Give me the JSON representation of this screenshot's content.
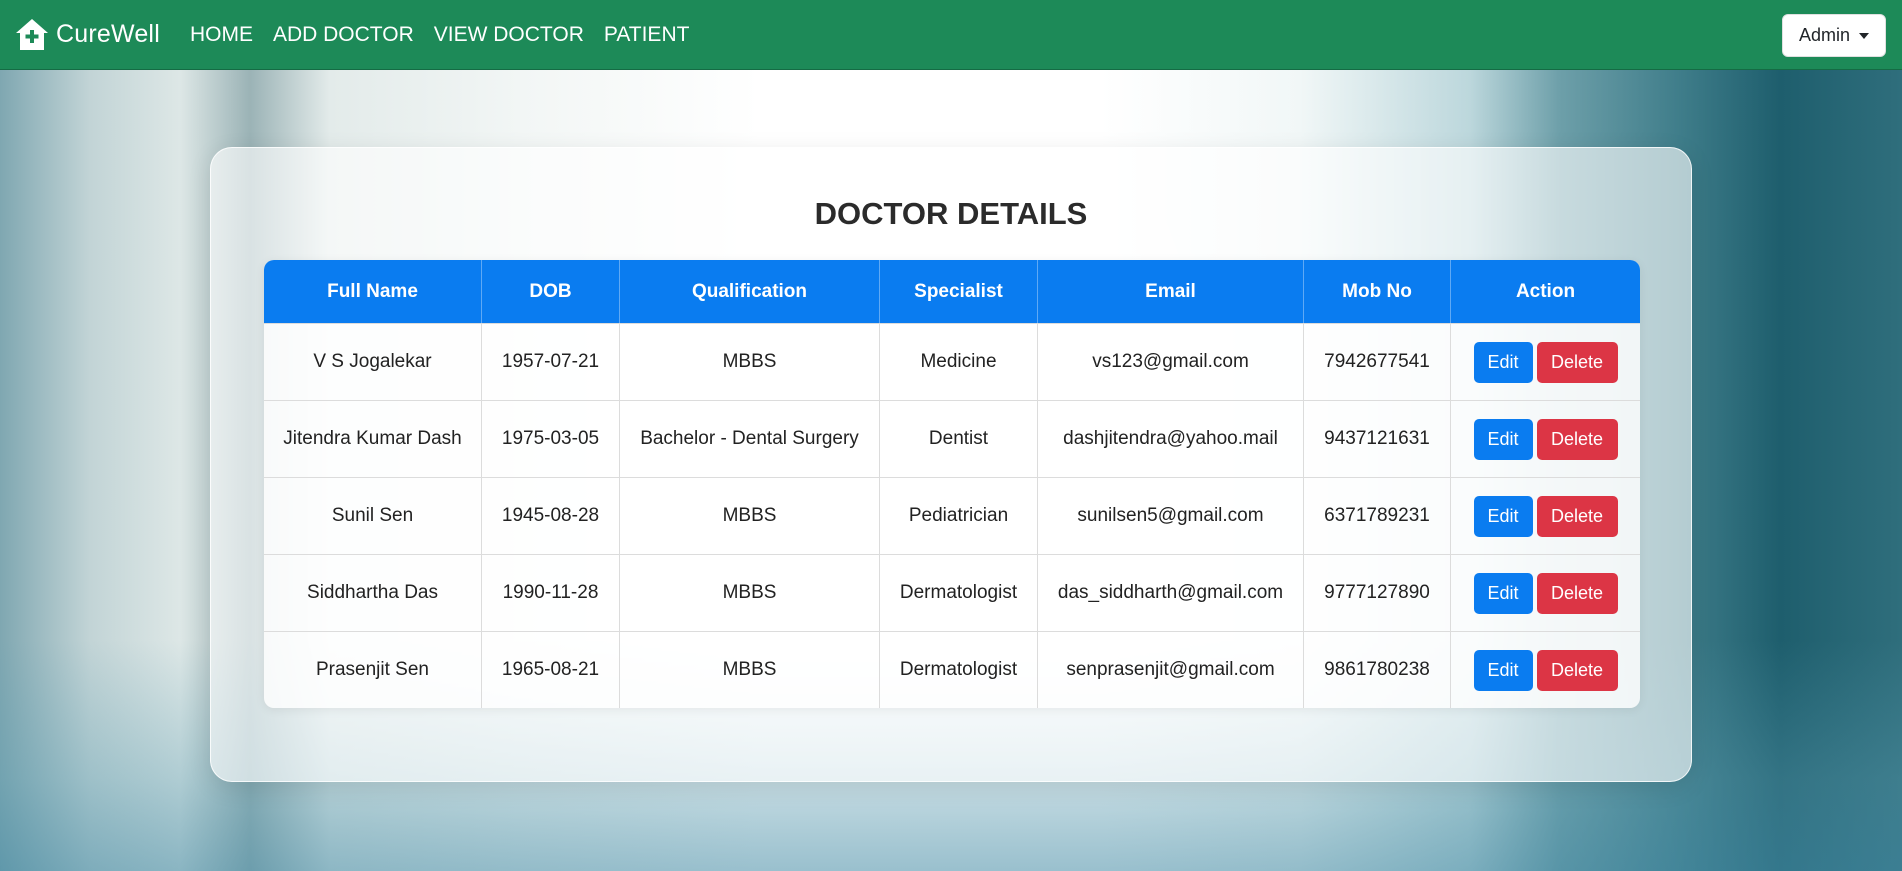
{
  "brand": {
    "name": "CureWell",
    "icon": "house-plus-icon"
  },
  "nav": {
    "links": [
      {
        "label": "HOME"
      },
      {
        "label": "ADD DOCTOR"
      },
      {
        "label": "VIEW DOCTOR"
      },
      {
        "label": "PATIENT"
      }
    ],
    "user_menu_label": "Admin"
  },
  "colors": {
    "navbar": "#1d8a58",
    "table_header": "#0a7cf0",
    "edit_button": "#0a7cf0",
    "delete_button": "#dc3545"
  },
  "page": {
    "title": "DOCTOR DETAILS"
  },
  "table": {
    "columns": [
      "Full Name",
      "DOB",
      "Qualification",
      "Specialist",
      "Email",
      "Mob No",
      "Action"
    ],
    "rows": [
      {
        "full_name": "V S Jogalekar",
        "dob": "1957-07-21",
        "qualification": "MBBS",
        "specialist": "Medicine",
        "email": "vs123@gmail.com",
        "mobile": "7942677541"
      },
      {
        "full_name": "Jitendra Kumar Dash",
        "dob": "1975-03-05",
        "qualification": "Bachelor - Dental Surgery",
        "specialist": "Dentist",
        "email": "dashjitendra@yahoo.mail",
        "mobile": "9437121631"
      },
      {
        "full_name": "Sunil Sen",
        "dob": "1945-08-28",
        "qualification": "MBBS",
        "specialist": "Pediatrician",
        "email": "sunilsen5@gmail.com",
        "mobile": "6371789231"
      },
      {
        "full_name": "Siddhartha Das",
        "dob": "1990-11-28",
        "qualification": "MBBS",
        "specialist": "Dermatologist",
        "email": "das_siddharth@gmail.com",
        "mobile": "9777127890"
      },
      {
        "full_name": "Prasenjit Sen",
        "dob": "1965-08-21",
        "qualification": "MBBS",
        "specialist": "Dermatologist",
        "email": "senprasenjit@gmail.com",
        "mobile": "9861780238"
      }
    ],
    "edit_label": "Edit",
    "delete_label": "Delete"
  }
}
